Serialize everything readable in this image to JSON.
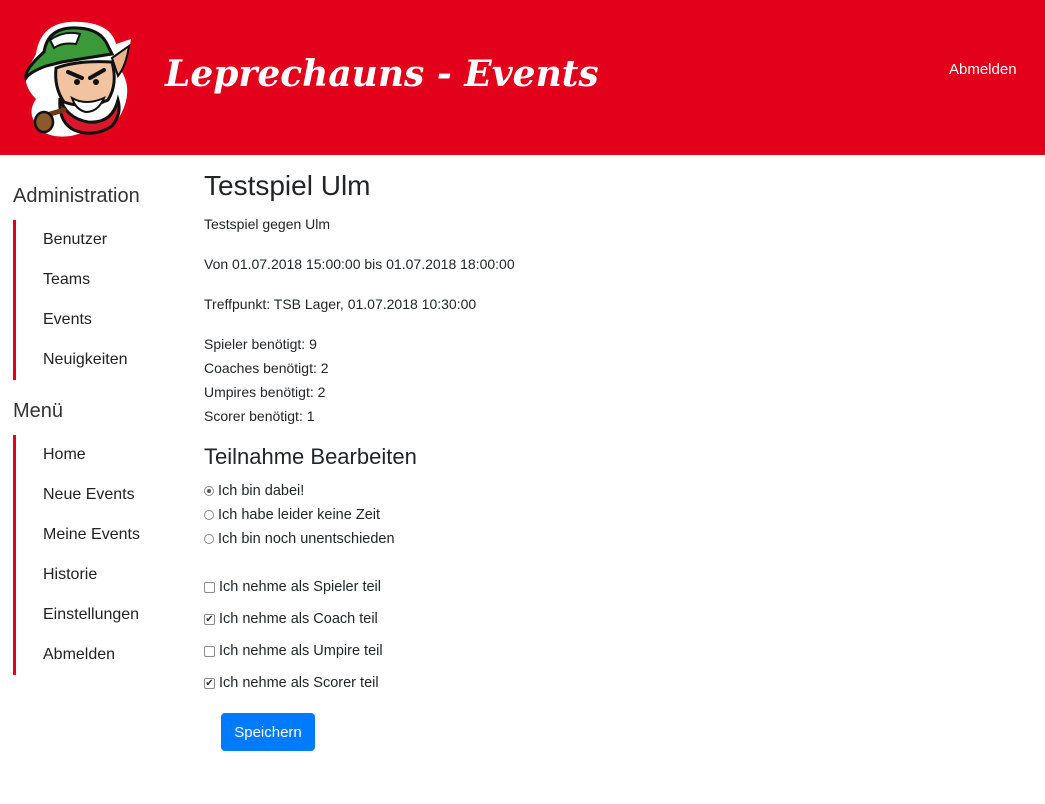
{
  "header": {
    "brand": "Leprechauns - Events",
    "logout": "Abmelden",
    "logo_icon": "leprechaun-mascot-logo",
    "background_color": "#e2001a"
  },
  "sidebar": {
    "admin_heading": "Administration",
    "admin_items": [
      "Benutzer",
      "Teams",
      "Events",
      "Neuigkeiten"
    ],
    "menu_heading": "Menü",
    "menu_items": [
      "Home",
      "Neue Events",
      "Meine Events",
      "Historie",
      "Einstellungen",
      "Abmelden"
    ],
    "accent_color": "#e2001a"
  },
  "event": {
    "title": "Testspiel Ulm",
    "description": "Testspiel gegen Ulm",
    "time": "Von 01.07.2018 15:00:00 bis 01.07.2018 18:00:00",
    "meeting": "Treffpunkt: TSB Lager, 01.07.2018 10:30:00",
    "needs": [
      "Spieler benötigt: 9",
      "Coaches benötigt: 2",
      "Umpires benötigt: 2",
      "Scorer benötigt: 1"
    ]
  },
  "participation": {
    "heading": "Teilnahme Bearbeiten",
    "radio_options": [
      {
        "label": "Ich bin dabei!",
        "selected": true
      },
      {
        "label": "Ich habe leider keine Zeit",
        "selected": false
      },
      {
        "label": "Ich bin noch unentschieden",
        "selected": false
      }
    ],
    "role_checkboxes": [
      {
        "label": "Ich nehme als Spieler teil",
        "checked": false
      },
      {
        "label": "Ich nehme als Coach teil",
        "checked": true
      },
      {
        "label": "Ich nehme als Umpire teil",
        "checked": false
      },
      {
        "label": "Ich nehme als Scorer teil",
        "checked": true
      }
    ],
    "save_label": "Speichern",
    "save_color": "#007bff"
  }
}
